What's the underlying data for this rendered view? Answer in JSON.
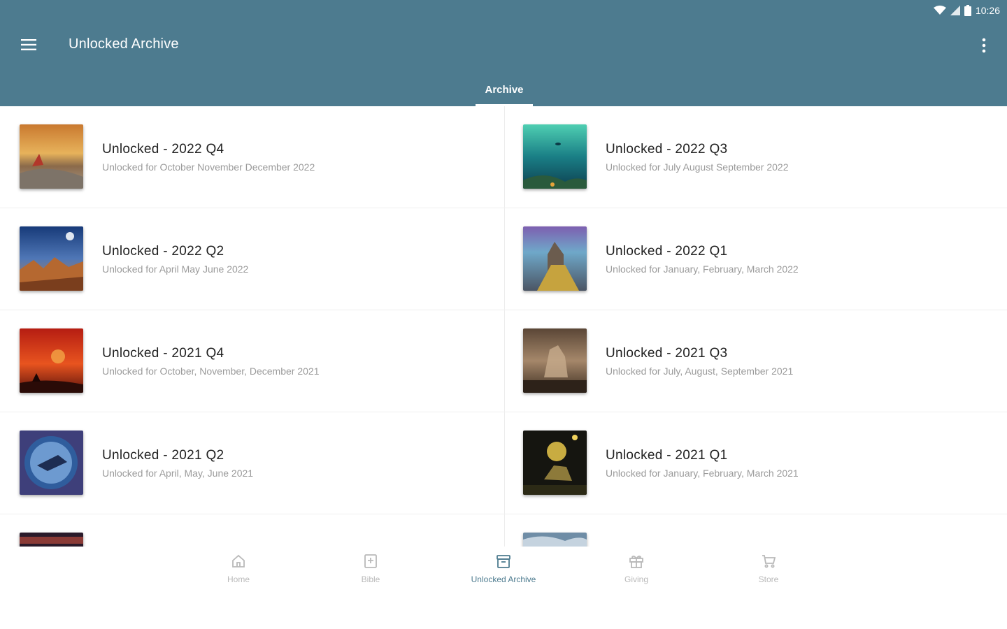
{
  "status_bar": {
    "time": "10:26"
  },
  "app_bar": {
    "title": "Unlocked Archive",
    "menu_icon": "hamburger-menu-icon",
    "more_icon": "more-vert-icon"
  },
  "tabs": [
    {
      "label": "Archive",
      "active": true
    }
  ],
  "items": [
    {
      "title": "Unlocked - 2022 Q4",
      "subtitle": "Unlocked for October November December 2022"
    },
    {
      "title": "Unlocked - 2022 Q3",
      "subtitle": "Unlocked for July August September 2022"
    },
    {
      "title": "Unlocked - 2022 Q2",
      "subtitle": "Unlocked for April May June 2022"
    },
    {
      "title": "Unlocked - 2022 Q1",
      "subtitle": "Unlocked for January, February, March 2022"
    },
    {
      "title": "Unlocked - 2021 Q4",
      "subtitle": "Unlocked for October, November, December 2021"
    },
    {
      "title": "Unlocked - 2021 Q3",
      "subtitle": "Unlocked for July, August, September 2021"
    },
    {
      "title": "Unlocked - 2021 Q2",
      "subtitle": "Unlocked for April, May, June 2021"
    },
    {
      "title": "Unlocked - 2021 Q1",
      "subtitle": "Unlocked for January, February, March 2021"
    }
  ],
  "bottom_nav": [
    {
      "label": "Home",
      "icon": "home-icon"
    },
    {
      "label": "Bible",
      "icon": "bible-icon"
    },
    {
      "label": "Unlocked Archive",
      "icon": "archive-icon",
      "active": true
    },
    {
      "label": "Giving",
      "icon": "gift-icon"
    },
    {
      "label": "Store",
      "icon": "cart-icon"
    }
  ],
  "colors": {
    "app_bar": "#4d7b8f",
    "active_nav": "#4d7b8f",
    "inactive_nav": "#b9b9b9"
  }
}
